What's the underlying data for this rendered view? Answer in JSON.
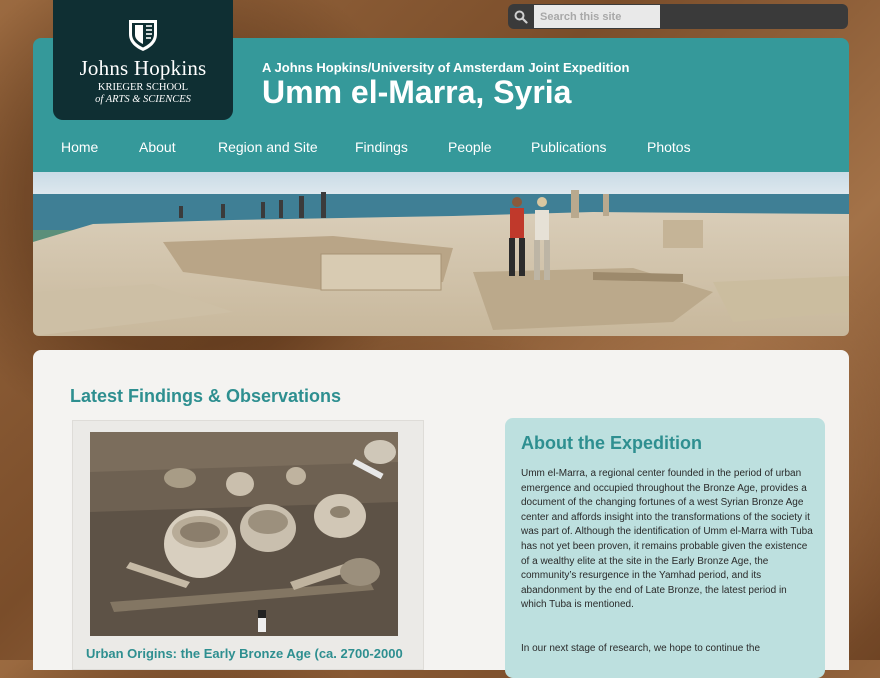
{
  "search": {
    "placeholder": "Search this site",
    "icon": "search-icon"
  },
  "logo": {
    "name": "Johns Hopkins",
    "school_line1": "KRIEGER SCHOOL",
    "school_line2": "of ARTS & SCIENCES",
    "icon": "shield-icon"
  },
  "header": {
    "subtitle": "A Johns Hopkins/University of Amsterdam Joint Expedition",
    "title": "Umm el-Marra, Syria"
  },
  "nav": {
    "items": [
      {
        "label": "Home"
      },
      {
        "label": "About"
      },
      {
        "label": "Region and Site"
      },
      {
        "label": "Findings"
      },
      {
        "label": "People"
      },
      {
        "label": "Publications"
      },
      {
        "label": "Photos"
      }
    ]
  },
  "main": {
    "latest_heading": "Latest Findings & Observations",
    "finding": {
      "title": "Urban Origins: the Early Bronze Age (ca. 2700-2000"
    }
  },
  "about": {
    "heading": "About the Expedition",
    "paragraph": "Umm el-Marra, a regional center founded in the period of urban emergence and occupied throughout the Bronze Age, provides a document of the changing fortunes of a west Syrian Bronze Age center and affords insight into the transformations of the society it was part of. Although the identification of Umm el-Marra with Tuba has not yet been proven, it remains probable given the existence of a wealthy elite at the site in the Early Bronze Age, the community’s resurgence in the Yamhad period, and its abandonment by the end of Late Bronze, the latest period in which Tuba is mentioned.",
    "paragraph2": "In our next stage of research, we hope to continue the"
  },
  "colors": {
    "header_teal": "#35999a",
    "logo_dark": "#0f2f33",
    "heading_teal": "#2e8f90",
    "about_bg": "#bde0df"
  }
}
